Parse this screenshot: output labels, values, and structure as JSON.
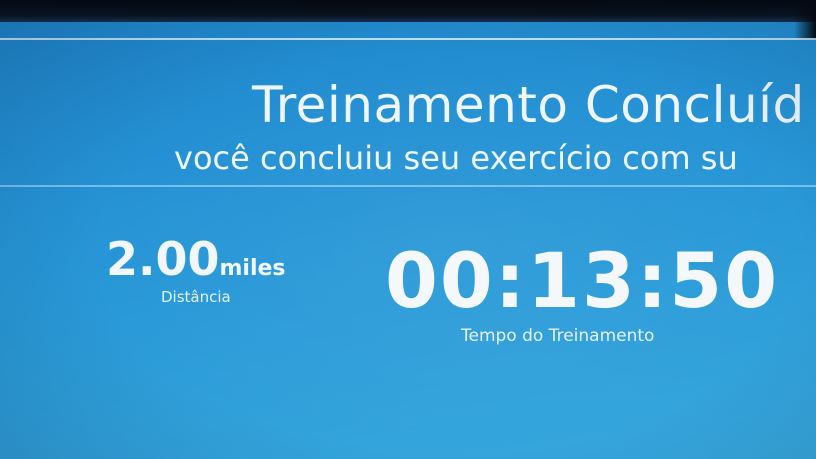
{
  "header": {
    "title": "Treinamento Concluíd",
    "subtitle": "você concluiu seu exercício com su"
  },
  "summary": {
    "distance_value": "2.00",
    "distance_unit": "miles",
    "distance_label": "Distância",
    "time_value": "00:13:50",
    "time_label": "Tempo do Treinamento"
  },
  "colors": {
    "background": "#2592d4",
    "text": "#eef6fc"
  }
}
